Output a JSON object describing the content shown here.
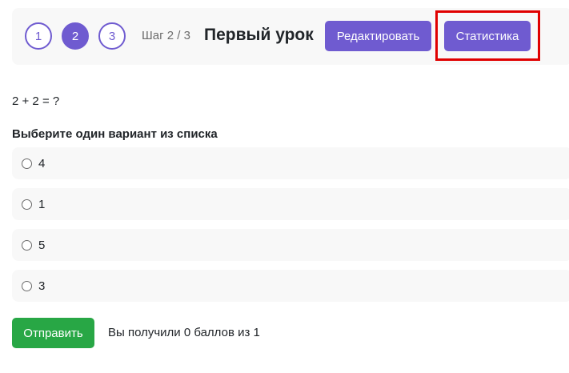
{
  "header": {
    "steps": [
      "1",
      "2",
      "3"
    ],
    "active_step": "2",
    "step_counter": "Шаг 2 / 3",
    "lesson_title": "Первый урок",
    "edit_label": "Редактировать",
    "stats_label": "Статистика"
  },
  "question": {
    "text": "2 + 2 = ?",
    "instruction": "Выберите один вариант из списка",
    "options": [
      "4",
      "1",
      "5",
      "3"
    ]
  },
  "footer": {
    "submit_label": "Отправить",
    "score_text": "Вы получили 0 баллов из 1"
  },
  "colors": {
    "accent": "#6f5bd0",
    "submit": "#28a745",
    "highlight": "#e00000",
    "panel": "#f8f8f8"
  }
}
